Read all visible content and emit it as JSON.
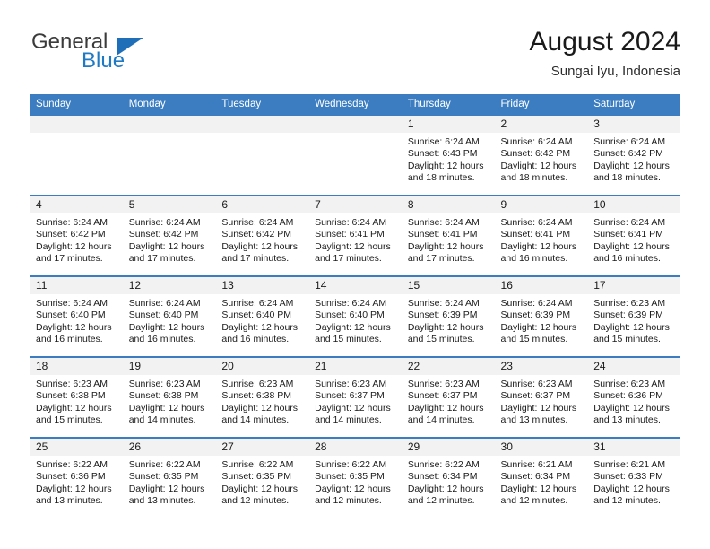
{
  "brand": {
    "name_top": "General",
    "name_bottom": "Blue",
    "flag_color": "#1f6fb8",
    "blue_color": "#1f7ac4"
  },
  "header": {
    "title": "August 2024",
    "location": "Sungai Iyu, Indonesia"
  },
  "theme": {
    "header_bg": "#3b7dc0",
    "daynum_bg": "#f2f2f2",
    "row_divider": "#3b7dc0"
  },
  "weekday_headers": [
    "Sunday",
    "Monday",
    "Tuesday",
    "Wednesday",
    "Thursday",
    "Friday",
    "Saturday"
  ],
  "labels": {
    "sunrise_prefix": "Sunrise:",
    "sunset_prefix": "Sunset:",
    "daylight_prefix": "Daylight:"
  },
  "weeks": [
    [
      {
        "empty": true
      },
      {
        "empty": true
      },
      {
        "empty": true
      },
      {
        "empty": true
      },
      {
        "day": "1",
        "sunrise": "Sunrise: 6:24 AM",
        "sunset": "Sunset: 6:43 PM",
        "daylight_line1": "Daylight: 12 hours",
        "daylight_line2": "and 18 minutes."
      },
      {
        "day": "2",
        "sunrise": "Sunrise: 6:24 AM",
        "sunset": "Sunset: 6:42 PM",
        "daylight_line1": "Daylight: 12 hours",
        "daylight_line2": "and 18 minutes."
      },
      {
        "day": "3",
        "sunrise": "Sunrise: 6:24 AM",
        "sunset": "Sunset: 6:42 PM",
        "daylight_line1": "Daylight: 12 hours",
        "daylight_line2": "and 18 minutes."
      }
    ],
    [
      {
        "day": "4",
        "sunrise": "Sunrise: 6:24 AM",
        "sunset": "Sunset: 6:42 PM",
        "daylight_line1": "Daylight: 12 hours",
        "daylight_line2": "and 17 minutes."
      },
      {
        "day": "5",
        "sunrise": "Sunrise: 6:24 AM",
        "sunset": "Sunset: 6:42 PM",
        "daylight_line1": "Daylight: 12 hours",
        "daylight_line2": "and 17 minutes."
      },
      {
        "day": "6",
        "sunrise": "Sunrise: 6:24 AM",
        "sunset": "Sunset: 6:42 PM",
        "daylight_line1": "Daylight: 12 hours",
        "daylight_line2": "and 17 minutes."
      },
      {
        "day": "7",
        "sunrise": "Sunrise: 6:24 AM",
        "sunset": "Sunset: 6:41 PM",
        "daylight_line1": "Daylight: 12 hours",
        "daylight_line2": "and 17 minutes."
      },
      {
        "day": "8",
        "sunrise": "Sunrise: 6:24 AM",
        "sunset": "Sunset: 6:41 PM",
        "daylight_line1": "Daylight: 12 hours",
        "daylight_line2": "and 17 minutes."
      },
      {
        "day": "9",
        "sunrise": "Sunrise: 6:24 AM",
        "sunset": "Sunset: 6:41 PM",
        "daylight_line1": "Daylight: 12 hours",
        "daylight_line2": "and 16 minutes."
      },
      {
        "day": "10",
        "sunrise": "Sunrise: 6:24 AM",
        "sunset": "Sunset: 6:41 PM",
        "daylight_line1": "Daylight: 12 hours",
        "daylight_line2": "and 16 minutes."
      }
    ],
    [
      {
        "day": "11",
        "sunrise": "Sunrise: 6:24 AM",
        "sunset": "Sunset: 6:40 PM",
        "daylight_line1": "Daylight: 12 hours",
        "daylight_line2": "and 16 minutes."
      },
      {
        "day": "12",
        "sunrise": "Sunrise: 6:24 AM",
        "sunset": "Sunset: 6:40 PM",
        "daylight_line1": "Daylight: 12 hours",
        "daylight_line2": "and 16 minutes."
      },
      {
        "day": "13",
        "sunrise": "Sunrise: 6:24 AM",
        "sunset": "Sunset: 6:40 PM",
        "daylight_line1": "Daylight: 12 hours",
        "daylight_line2": "and 16 minutes."
      },
      {
        "day": "14",
        "sunrise": "Sunrise: 6:24 AM",
        "sunset": "Sunset: 6:40 PM",
        "daylight_line1": "Daylight: 12 hours",
        "daylight_line2": "and 15 minutes."
      },
      {
        "day": "15",
        "sunrise": "Sunrise: 6:24 AM",
        "sunset": "Sunset: 6:39 PM",
        "daylight_line1": "Daylight: 12 hours",
        "daylight_line2": "and 15 minutes."
      },
      {
        "day": "16",
        "sunrise": "Sunrise: 6:24 AM",
        "sunset": "Sunset: 6:39 PM",
        "daylight_line1": "Daylight: 12 hours",
        "daylight_line2": "and 15 minutes."
      },
      {
        "day": "17",
        "sunrise": "Sunrise: 6:23 AM",
        "sunset": "Sunset: 6:39 PM",
        "daylight_line1": "Daylight: 12 hours",
        "daylight_line2": "and 15 minutes."
      }
    ],
    [
      {
        "day": "18",
        "sunrise": "Sunrise: 6:23 AM",
        "sunset": "Sunset: 6:38 PM",
        "daylight_line1": "Daylight: 12 hours",
        "daylight_line2": "and 15 minutes."
      },
      {
        "day": "19",
        "sunrise": "Sunrise: 6:23 AM",
        "sunset": "Sunset: 6:38 PM",
        "daylight_line1": "Daylight: 12 hours",
        "daylight_line2": "and 14 minutes."
      },
      {
        "day": "20",
        "sunrise": "Sunrise: 6:23 AM",
        "sunset": "Sunset: 6:38 PM",
        "daylight_line1": "Daylight: 12 hours",
        "daylight_line2": "and 14 minutes."
      },
      {
        "day": "21",
        "sunrise": "Sunrise: 6:23 AM",
        "sunset": "Sunset: 6:37 PM",
        "daylight_line1": "Daylight: 12 hours",
        "daylight_line2": "and 14 minutes."
      },
      {
        "day": "22",
        "sunrise": "Sunrise: 6:23 AM",
        "sunset": "Sunset: 6:37 PM",
        "daylight_line1": "Daylight: 12 hours",
        "daylight_line2": "and 14 minutes."
      },
      {
        "day": "23",
        "sunrise": "Sunrise: 6:23 AM",
        "sunset": "Sunset: 6:37 PM",
        "daylight_line1": "Daylight: 12 hours",
        "daylight_line2": "and 13 minutes."
      },
      {
        "day": "24",
        "sunrise": "Sunrise: 6:23 AM",
        "sunset": "Sunset: 6:36 PM",
        "daylight_line1": "Daylight: 12 hours",
        "daylight_line2": "and 13 minutes."
      }
    ],
    [
      {
        "day": "25",
        "sunrise": "Sunrise: 6:22 AM",
        "sunset": "Sunset: 6:36 PM",
        "daylight_line1": "Daylight: 12 hours",
        "daylight_line2": "and 13 minutes."
      },
      {
        "day": "26",
        "sunrise": "Sunrise: 6:22 AM",
        "sunset": "Sunset: 6:35 PM",
        "daylight_line1": "Daylight: 12 hours",
        "daylight_line2": "and 13 minutes."
      },
      {
        "day": "27",
        "sunrise": "Sunrise: 6:22 AM",
        "sunset": "Sunset: 6:35 PM",
        "daylight_line1": "Daylight: 12 hours",
        "daylight_line2": "and 12 minutes."
      },
      {
        "day": "28",
        "sunrise": "Sunrise: 6:22 AM",
        "sunset": "Sunset: 6:35 PM",
        "daylight_line1": "Daylight: 12 hours",
        "daylight_line2": "and 12 minutes."
      },
      {
        "day": "29",
        "sunrise": "Sunrise: 6:22 AM",
        "sunset": "Sunset: 6:34 PM",
        "daylight_line1": "Daylight: 12 hours",
        "daylight_line2": "and 12 minutes."
      },
      {
        "day": "30",
        "sunrise": "Sunrise: 6:21 AM",
        "sunset": "Sunset: 6:34 PM",
        "daylight_line1": "Daylight: 12 hours",
        "daylight_line2": "and 12 minutes."
      },
      {
        "day": "31",
        "sunrise": "Sunrise: 6:21 AM",
        "sunset": "Sunset: 6:33 PM",
        "daylight_line1": "Daylight: 12 hours",
        "daylight_line2": "and 12 minutes."
      }
    ]
  ]
}
